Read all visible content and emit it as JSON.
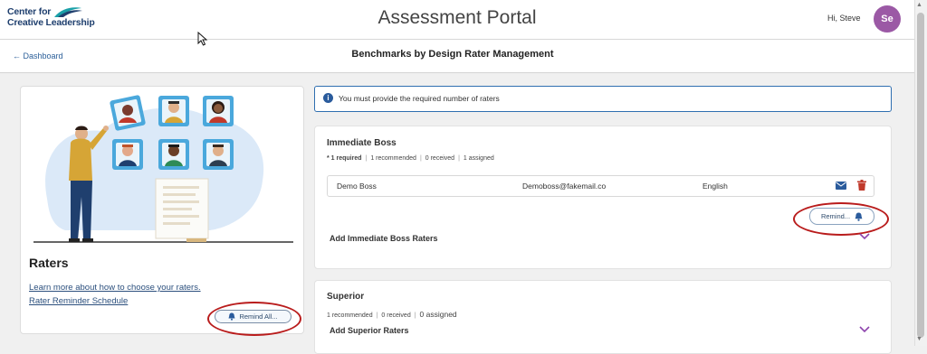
{
  "header": {
    "logo_line1": "Center for",
    "logo_line2": "Creative Leadership",
    "portal_title": "Assessment Portal",
    "greeting": "Hi, Steve",
    "avatar_initials": "Se",
    "avatar_color": "#9b59a5"
  },
  "subheader": {
    "back_label": "Dashboard",
    "page_title": "Benchmarks by Design Rater Management"
  },
  "left_panel": {
    "title": "Raters",
    "learn_link": "Learn more about how to choose your raters.",
    "schedule_link": "Rater Reminder Schedule",
    "remind_all_label": "Remind All..."
  },
  "info_banner": {
    "icon": "info-icon",
    "text": "You must provide the required number of raters"
  },
  "immediate_boss": {
    "title": "Immediate Boss",
    "required": "* 1 required",
    "recommended": "1 recommended",
    "received": "0 received",
    "assigned": "1 assigned",
    "rater": {
      "name": "Demo Boss",
      "email": "Demoboss@fakemail.co",
      "language": "English"
    },
    "remind_label": "Remind...",
    "add_label": "Add Immediate Boss Raters"
  },
  "superior": {
    "title": "Superior",
    "recommended": "1 recommended",
    "received": "0 received",
    "assigned": "0 assigned",
    "add_label": "Add Superior Raters"
  },
  "colors": {
    "accent": "#2a5b9c",
    "highlight_ring": "#b91c1c",
    "delete": "#c0392b",
    "chevron": "#8e44ad",
    "illustration_bg": "#dbe9f8"
  }
}
